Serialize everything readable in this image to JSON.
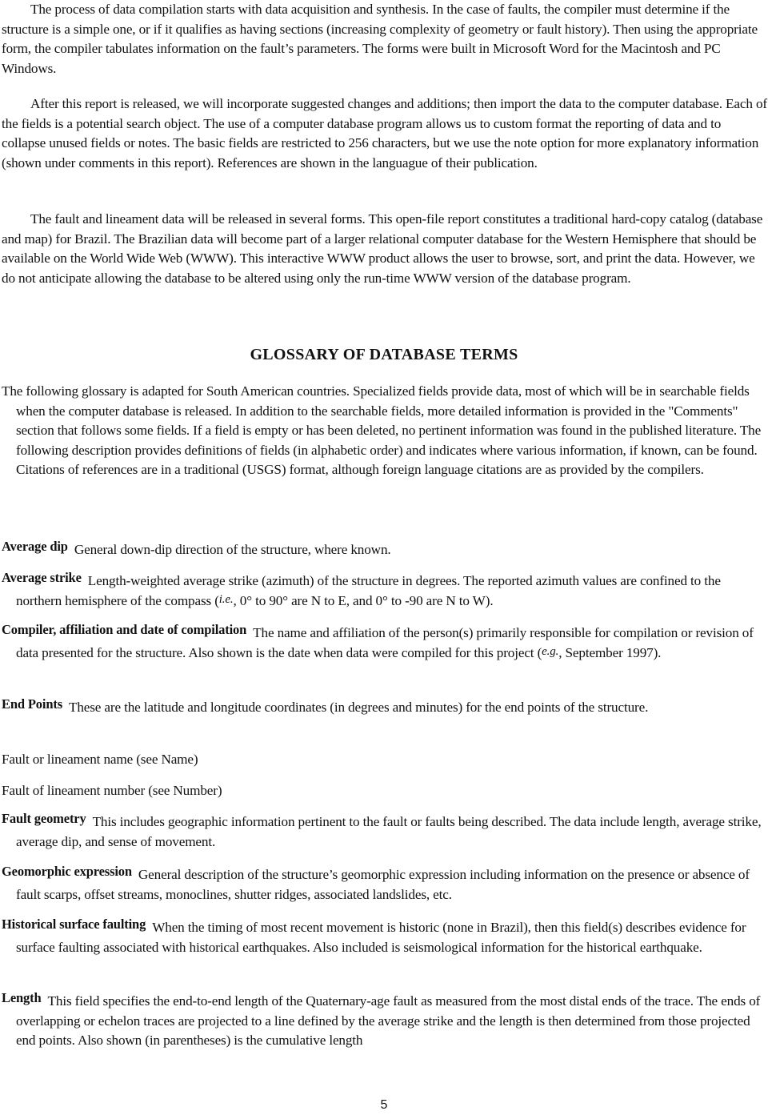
{
  "paragraphs": [
    "The process of data compilation starts with data acquisition and synthesis.  In the case of faults, the compiler must determine if the structure is a simple one, or if it qualifies as having sections (increasing complexity of geometry or fault history).  Then using the appropriate form, the compiler tabulates information on the fault’s parameters.  The forms were built in Microsoft Word for the Macintosh and PC Windows.",
    "After this report is released, we will incorporate suggested changes and additions; then import the data to the computer database.  Each of the fields is a potential search object.  The use of a computer database program allows us to custom format the reporting of data and to collapse unused fields or notes.  The basic fields are restricted to 256 characters, but we use the note option for more explanatory information (shown under comments in this report).  References are shown in the languague of their publication.",
    "The fault and lineament data will be released in several forms.  This open-file report constitutes a traditional hard-copy catalog (database and map) for Brazil.  The Brazilian data will become part of a larger relational computer database for the Western Hemisphere that should be available on the World Wide Web (WWW).  This interactive WWW product allows the user to browse, sort, and print the data.  However, we do not anticipate allowing the database to be altered using only the run-time WWW version of the database program."
  ],
  "glossary": {
    "heading": "GLOSSARY OF DATABASE TERMS",
    "intro": "The following glossary is adapted for South American countries.  Specialized fields provide data, most of which will be in searchable fields when the computer database is released.  In addition to the searchable fields, more detailed information is provided in the \"Comments\" section that follows some fields.  If a field is empty or has been deleted, no pertinent information was found in the published literature.  The following description provides definitions of fields (in alphabetic order) and indicates where various information, if known, can be found.  Citations of references are in a traditional (USGS) format, although foreign language citations are as provided by the compilers.",
    "entries": [
      {
        "term": "Average dip",
        "definition": "General down-dip direction of the structure, where known."
      },
      {
        "term": "Average strike",
        "definition_before": "Length-weighted average strike (azimuth) of the structure in degrees.  The reported azimuth values are confined to the northern hemisphere of the compass (",
        "italic": "i.e.",
        "definition_after": ", 0° to 90° are N to E, and 0° to -90 are N to W)."
      },
      {
        "term": "Compiler, affiliation and date of compilation",
        "definition_before": "The name and affiliation of the person(s) primarily responsible for compilation or revision of data presented for the structure.  Also shown is the date when data were compiled for this project (",
        "italic": "e.g.",
        "definition_after": ", September 1997)."
      },
      {
        "term": "End Points",
        "definition": "These are the latitude and longitude coordinates (in degrees and minutes) for the end points of the structure."
      },
      {
        "plain": "Fault or lineament name (see Name)"
      },
      {
        "plain": "Fault of lineament number (see Number)"
      },
      {
        "term": "Fault geometry",
        "definition": "This includes geographic information pertinent to the fault or faults being described.  The data include length, average strike, average dip, and sense of movement."
      },
      {
        "term": "Geomorphic expression",
        "definition": "General description of the structure’s geomorphic expression including information on the presence or absence of fault scarps, offset streams, monoclines, shutter ridges, associated landslides, etc."
      },
      {
        "term": "Historical surface faulting",
        "definition": "When the timing of most recent movement is historic (none in Brazil), then this field(s) describes evidence for surface faulting associated with historical earthquakes.  Also included is seismological information for the historical earthquake."
      },
      {
        "term": "Length",
        "definition": "This field specifies the end-to-end length of the Quaternary-age fault as measured from the most distal ends of the trace.  The ends of overlapping or echelon traces are projected to a line defined by the average strike and the length is then determined from those projected end points.  Also shown (in parentheses) is the cumulative length"
      }
    ]
  },
  "page_number": "5"
}
